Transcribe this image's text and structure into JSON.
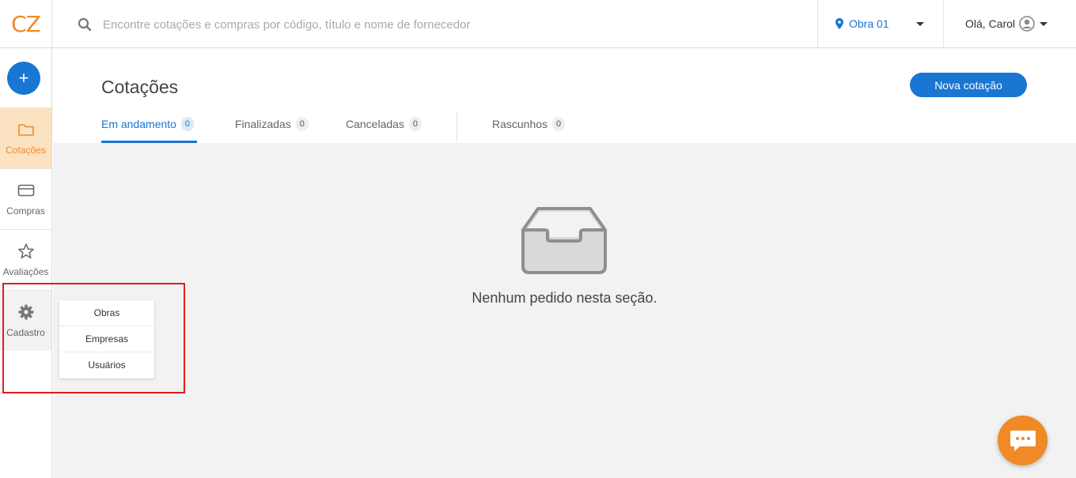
{
  "brand": {
    "logo_text": "CZ",
    "accent": "#f08a24",
    "primary": "#1976d2"
  },
  "search": {
    "icon": "search-icon",
    "placeholder": "Encontre cotações e compras por código, título e nome de fornecedor",
    "value": ""
  },
  "obra_selector": {
    "icon": "map-pin-icon",
    "label": "Obra 01"
  },
  "user": {
    "greeting": "Olá, Carol",
    "avatar_icon": "user-circle-icon"
  },
  "sidebar": {
    "add_label": "+",
    "items": [
      {
        "label": "Cotações",
        "icon": "folder-icon",
        "active": true
      },
      {
        "label": "Compras",
        "icon": "credit-card-icon"
      },
      {
        "label": "Avaliações",
        "icon": "star-icon"
      },
      {
        "label": "Cadastro",
        "icon": "gear-icon"
      }
    ]
  },
  "cadastro_menu": {
    "items": [
      "Obras",
      "Empresas",
      "Usuários"
    ]
  },
  "page": {
    "title": "Cotações",
    "new_button": "Nova cotação",
    "tabs": [
      {
        "label": "Em andamento",
        "count": "0",
        "active": true
      },
      {
        "label": "Finalizadas",
        "count": "0"
      },
      {
        "label": "Canceladas",
        "count": "0"
      },
      {
        "label": "Rascunhos",
        "count": "0"
      }
    ],
    "empty_state": {
      "icon": "inbox-tray-icon",
      "message": "Nenhum pedido nesta seção."
    }
  },
  "chat": {
    "icon": "chat-bubble-icon"
  }
}
